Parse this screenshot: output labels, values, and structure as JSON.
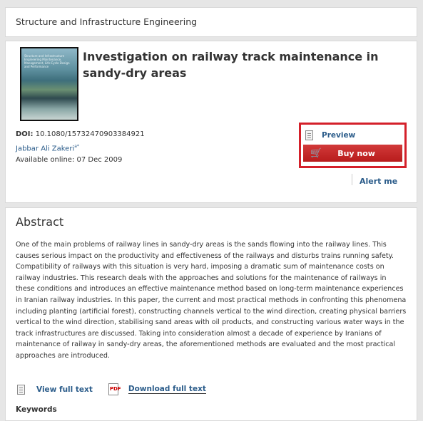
{
  "journal": {
    "title": "Structure and Infrastructure Engineering"
  },
  "cover": {
    "text": "Structure and Infrastructure Engineering Maintenance, Management, Life-Cycle Design and Performance"
  },
  "article": {
    "title": "Investigation on railway track maintenance in sandy-dry areas",
    "doi_label": "DOI:",
    "doi_value": "10.1080/15732470903384921",
    "author": "Jabbar Ali Zakeri",
    "author_sup": "a*",
    "available": "Available online: 07 Dec 2009"
  },
  "actions": {
    "preview_label": "Preview",
    "buy_label": "Buy now",
    "alert_label": "Alert me"
  },
  "abstract": {
    "heading": "Abstract",
    "text": "One of the main problems of railway lines in sandy-dry areas is the sands flowing into the railway lines. This causes serious impact on the productivity and effectiveness of the railways and disturbs trains running safety. Compatibility of railways with this situation is very hard, imposing a dramatic sum of maintenance costs on railway industries. This research deals with the approaches and solutions for the maintenance of railways in these conditions and introduces an effective maintenance method based on long-term maintenance experiences in Iranian railway industries. In this paper, the current and most practical methods in confronting this phenomena including planting (artificial forest), constructing channels vertical to the wind direction, creating physical barriers vertical to the wind direction, stabilising sand areas with oil products, and constructing various water ways in the track infrastructures are discussed. Taking into consideration almost a decade of experience by Iranians of maintenance of railway in sandy-dry areas, the aforementioned methods are evaluated and the most practical approaches are introduced.",
    "view_full_text": "View full text",
    "download_full_text": "Download full text",
    "pdf_icon_text": "PDF",
    "keywords_label": "Keywords"
  },
  "icons": {
    "preview": "document-icon",
    "cart": "cart-icon",
    "view": "document-icon",
    "download": "pdf-icon"
  },
  "colors": {
    "accent_red": "#d4202a",
    "link_blue": "#2b5c8a"
  }
}
